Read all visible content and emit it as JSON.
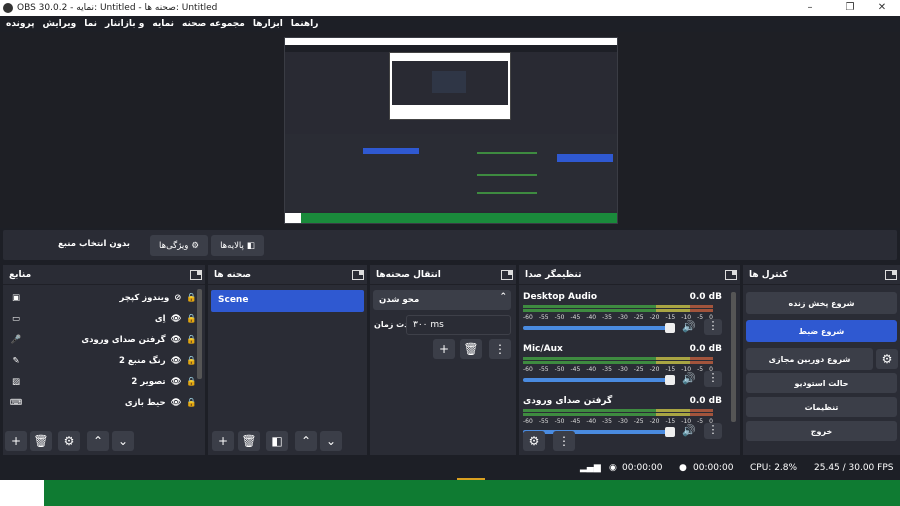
{
  "window": {
    "title": "OBS 30.0.2 - نمایه: Untitled - صحنه ها: Untitled",
    "min": "–",
    "max": "❐",
    "close": "✕"
  },
  "menu": [
    "پرونده",
    "ویرایش",
    "نما",
    "و بازاننار",
    "نمایه",
    "مجموعه صحنه",
    "ابزارها",
    "راهنما"
  ],
  "toolbar": {
    "no_source": "بدون انتخاب منبع",
    "properties": "ویژگی‌ها",
    "filters": "پالایه‌ها"
  },
  "docks": {
    "sources": {
      "title": "منابع",
      "items": [
        {
          "label": "ویندوز کپچر",
          "icon": "window-capture-icon"
        },
        {
          "label": "اِی",
          "icon": "window-icon"
        },
        {
          "label": "گرفتن صدای ورودی",
          "icon": "microphone-icon"
        },
        {
          "label": "رنگ منبع 2",
          "icon": "brush-icon"
        },
        {
          "label": "تصویر 2",
          "icon": "image-icon"
        },
        {
          "label": "حیط بازی",
          "icon": "gamepad-icon"
        }
      ]
    },
    "scenes": {
      "title": "صحنه ها",
      "items": [
        "Scene"
      ]
    },
    "transitions": {
      "title": "انتقال صحنه‌ها",
      "type": "محو شدن",
      "duration_label": "مدت زمان",
      "duration_value": "۳۰۰ ms"
    },
    "mixer": {
      "title": "تنظیمگر صدا",
      "channels": [
        {
          "name": "Desktop Audio",
          "db": "0.0 dB",
          "level": 0.75
        },
        {
          "name": "Mic/Aux",
          "db": "0.0 dB",
          "level": 0.75
        },
        {
          "name": "گرفتن صدای ورودی",
          "db": "0.0 dB",
          "level": 0.75
        }
      ],
      "scale": [
        "-60",
        "-55",
        "-50",
        "-45",
        "-40",
        "-35",
        "-30",
        "-25",
        "-20",
        "-15",
        "-10",
        "-5",
        "0"
      ]
    },
    "controls": {
      "title": "کنترل ها",
      "stream": "شروع پخش زنده",
      "record": "شروع ضبط",
      "virtualcam": "شروع دوربین مجازی",
      "studio": "حالت استودیو",
      "settings": "تنظیمات",
      "exit": "خروج"
    }
  },
  "status": {
    "live": "00:00:00",
    "rec": "00:00:00",
    "cpu": "CPU: 2.8%",
    "fps": "25.45 / 30.00 FPS"
  },
  "colors": {
    "accent": "#2f59d1",
    "dock": "#2a2c35",
    "bg": "#1d1f26",
    "green": "#0f7b32"
  }
}
